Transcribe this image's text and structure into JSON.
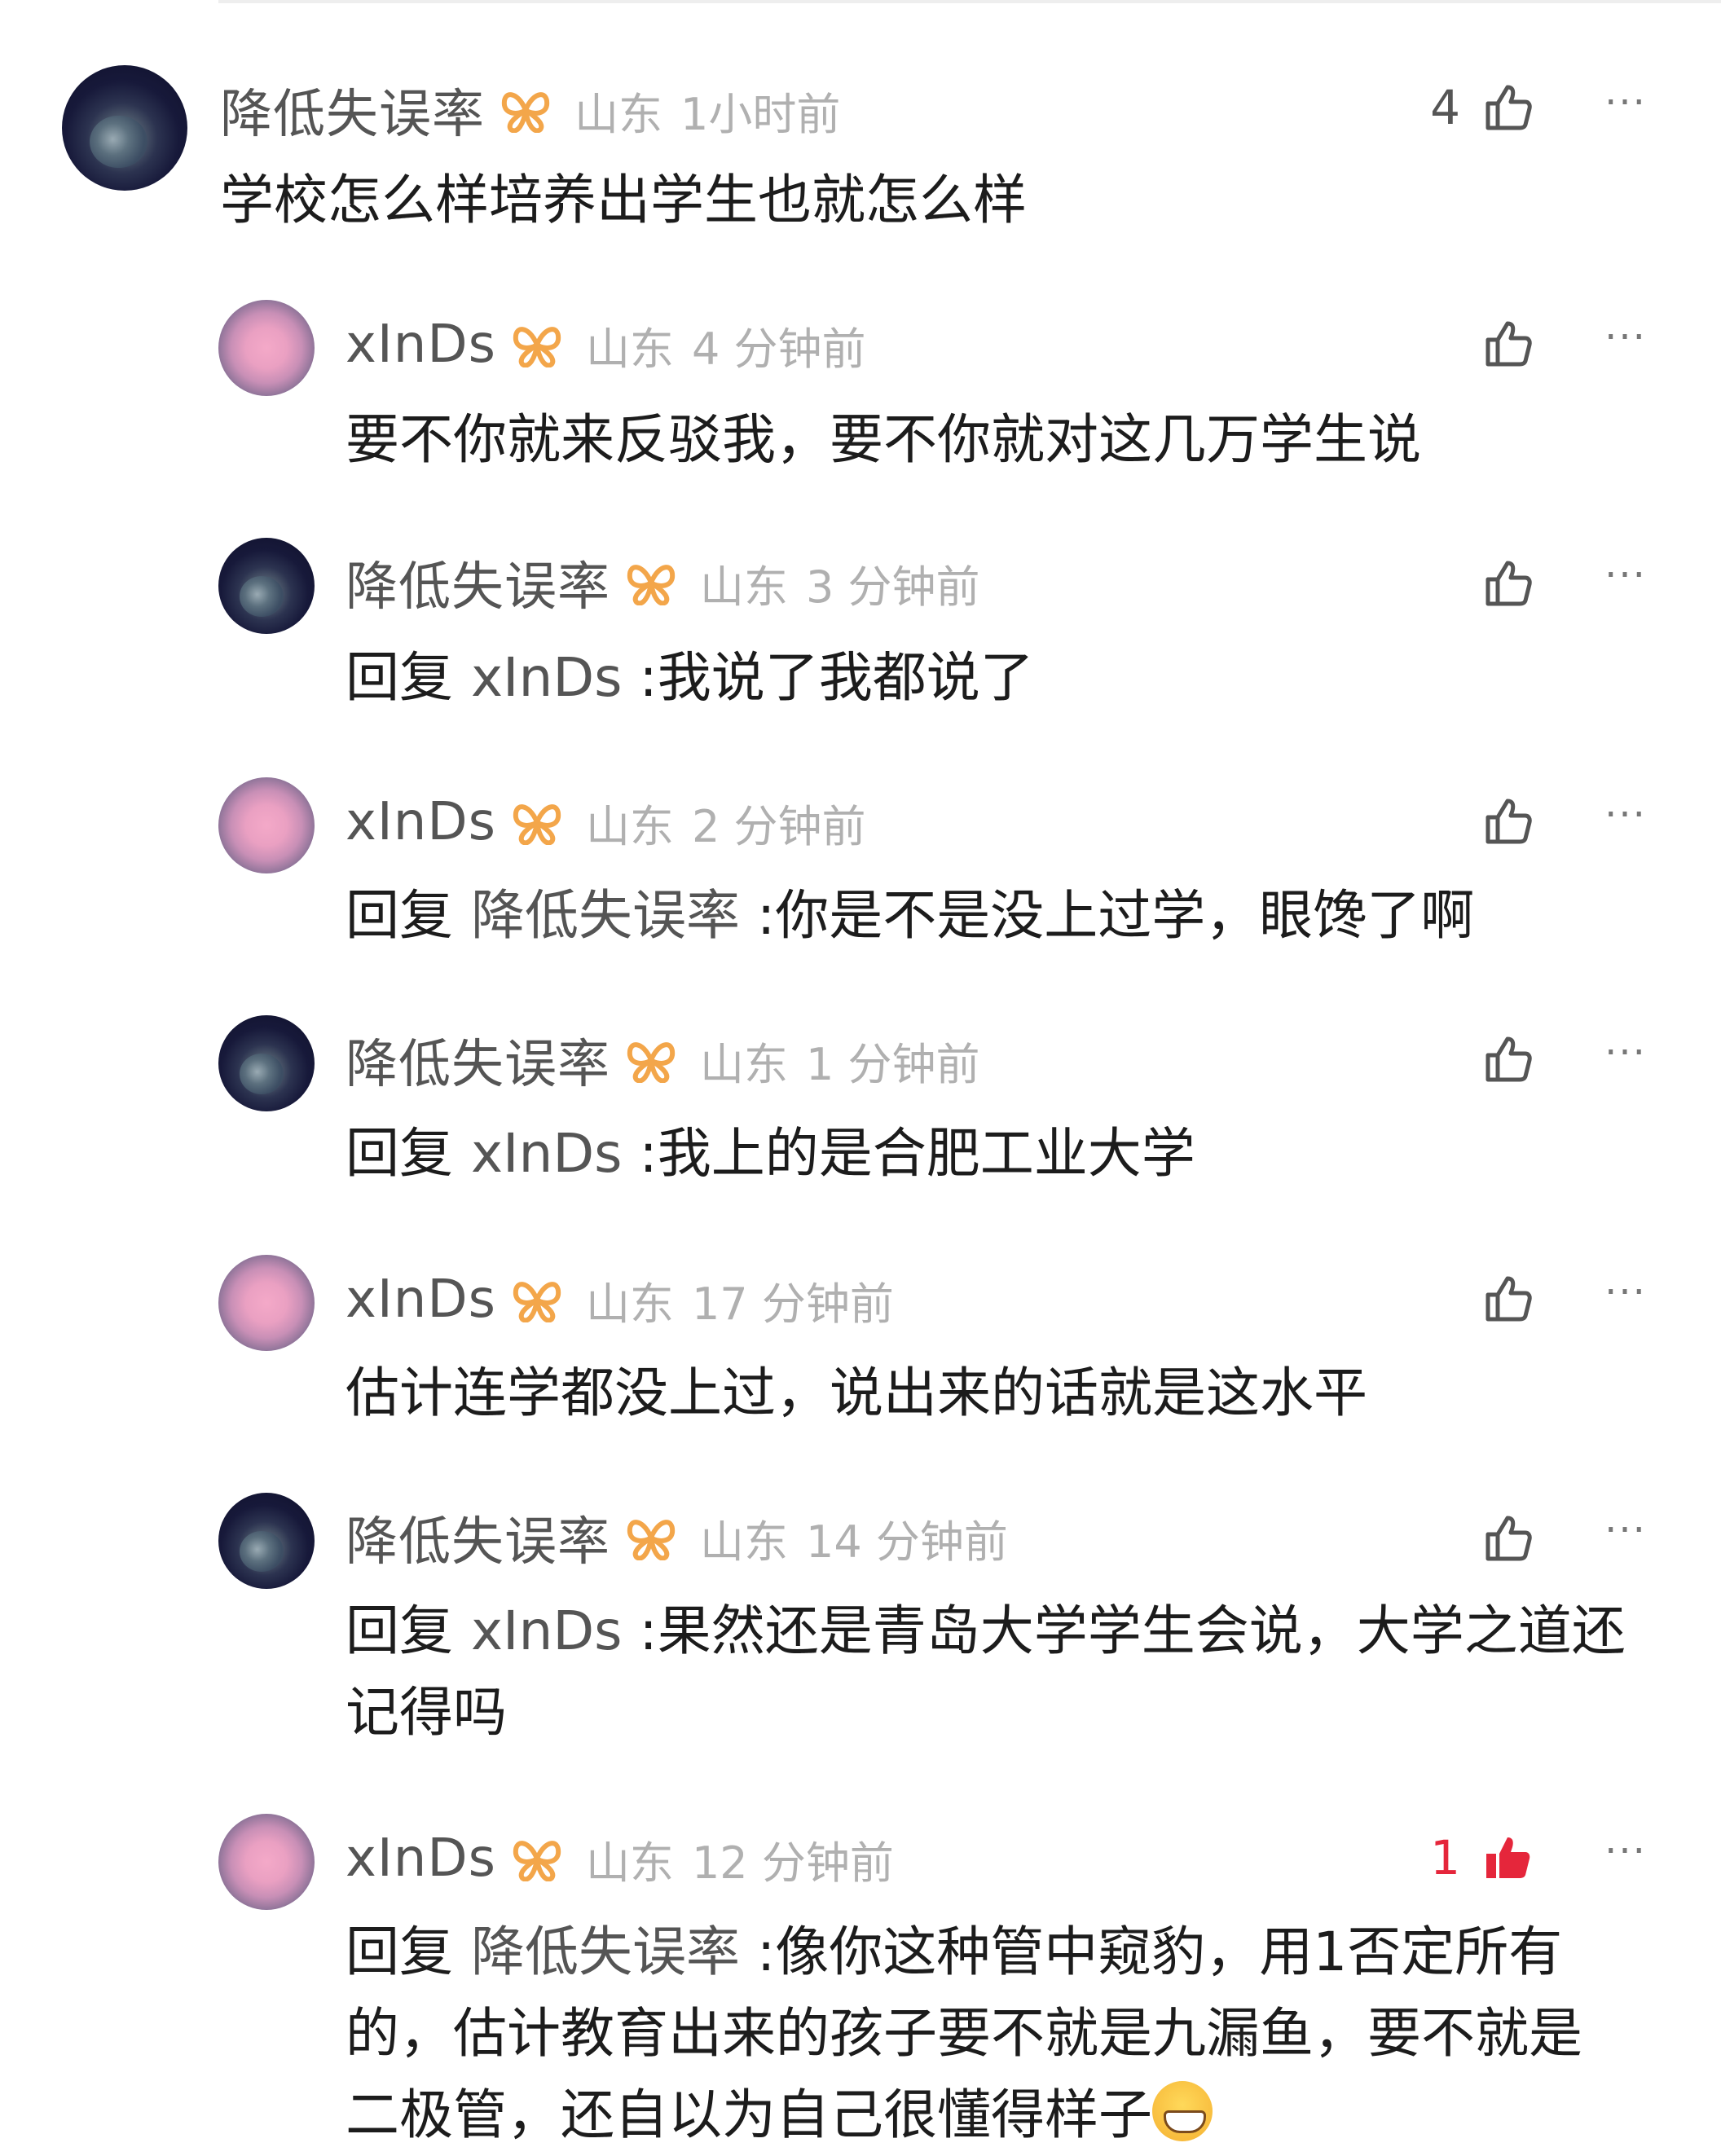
{
  "comments": [
    {
      "name": "降低失误率",
      "location": "山东",
      "time": "1小时前",
      "likes": "4",
      "text": "学校怎么样培养出学生也就怎么样",
      "avatar": "earth",
      "liked": false
    },
    {
      "name": "xInDs",
      "location": "山东",
      "time": "4 分钟前",
      "likes": "",
      "text": "要不你就来反驳我，要不你就对这几万学生说",
      "avatar": "pink",
      "liked": false
    },
    {
      "name": "降低失误率",
      "location": "山东",
      "time": "3 分钟前",
      "likes": "",
      "reply_prefix": "回复",
      "reply_target": "xInDs",
      "text": ":我说了我都说了",
      "avatar": "earth",
      "liked": false
    },
    {
      "name": "xInDs",
      "location": "山东",
      "time": "2 分钟前",
      "likes": "",
      "reply_prefix": "回复",
      "reply_target": "降低失误率",
      "text": ":你是不是没上过学，眼馋了啊",
      "avatar": "pink",
      "liked": false
    },
    {
      "name": "降低失误率",
      "location": "山东",
      "time": "1 分钟前",
      "likes": "",
      "reply_prefix": "回复",
      "reply_target": "xInDs",
      "text": ":我上的是合肥工业大学",
      "avatar": "earth",
      "liked": false
    },
    {
      "name": "xInDs",
      "location": "山东",
      "time": "17 分钟前",
      "likes": "",
      "text": "估计连学都没上过，说出来的话就是这水平",
      "avatar": "pink",
      "liked": false
    },
    {
      "name": "降低失误率",
      "location": "山东",
      "time": "14 分钟前",
      "likes": "",
      "reply_prefix": "回复",
      "reply_target": "xInDs",
      "text": ":果然还是青岛大学学生会说，大学之道还记得吗",
      "avatar": "earth",
      "liked": false
    },
    {
      "name": "xInDs",
      "location": "山东",
      "time": "12 分钟前",
      "likes": "1",
      "reply_prefix": "回复",
      "reply_target": "降低失误率",
      "text": ":像你这种管中窥豹，用1否定所有的，估计教育出来的孩子要不就是九漏鱼，要不就是二极管，还自以为自己很懂得样子",
      "avatar": "pink",
      "liked": true
    }
  ],
  "more_label": "···",
  "colors": {
    "liked": "#e5263b",
    "badge": "#f3a64a",
    "meta_gray": "#b0b0b0",
    "name_gray": "#555555"
  },
  "icons": {
    "like": "thumbs-up-icon",
    "liked": "thumbs-up-filled-icon",
    "more": "more-dots-icon",
    "badge": "butterfly-badge-icon",
    "emoji": "grinning-emoji-icon"
  }
}
